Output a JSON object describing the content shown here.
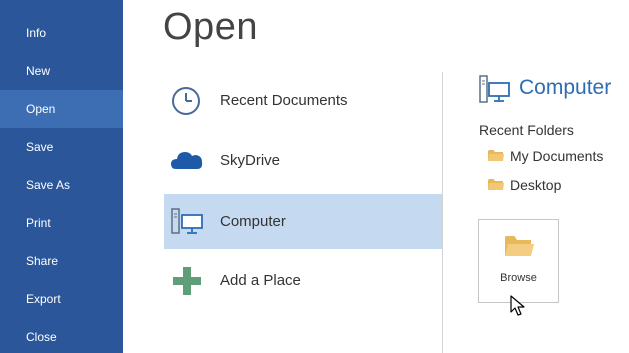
{
  "sidebar": {
    "items": [
      {
        "label": "Info"
      },
      {
        "label": "New"
      },
      {
        "label": "Open",
        "active": true
      },
      {
        "label": "Save"
      },
      {
        "label": "Save As"
      },
      {
        "label": "Print"
      },
      {
        "label": "Share"
      },
      {
        "label": "Export"
      },
      {
        "label": "Close"
      }
    ]
  },
  "page": {
    "title": "Open"
  },
  "places": [
    {
      "label": "Recent Documents",
      "icon": "clock-icon"
    },
    {
      "label": "SkyDrive",
      "icon": "cloud-icon"
    },
    {
      "label": "Computer",
      "icon": "computer-icon",
      "selected": true
    },
    {
      "label": "Add a Place",
      "icon": "plus-icon"
    }
  ],
  "right_panel": {
    "title": "Computer",
    "icon": "computer-icon",
    "recent_folders_heading": "Recent Folders",
    "folders": [
      {
        "label": "My Documents",
        "icon": "folder-icon"
      },
      {
        "label": "Desktop",
        "icon": "folder-icon"
      }
    ],
    "browse_label": "Browse",
    "browse_icon": "open-folder-icon"
  },
  "colors": {
    "sidebar_bg": "#2b579a",
    "sidebar_active": "#3d6db2",
    "selected_place": "#c5d9f1",
    "accent_text": "#2e6db4",
    "folder_yellow": "#f2c874"
  }
}
